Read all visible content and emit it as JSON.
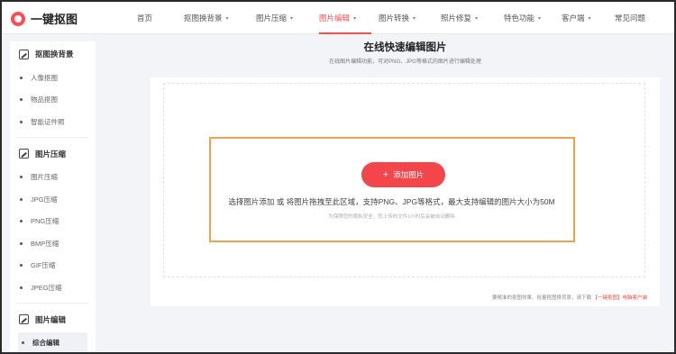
{
  "brand": {
    "name": "一键抠图"
  },
  "nav": [
    {
      "label": "首页",
      "dropdown": false,
      "active": false
    },
    {
      "label": "抠图换背景",
      "dropdown": true,
      "active": false
    },
    {
      "label": "图片压缩",
      "dropdown": true,
      "active": false
    },
    {
      "label": "图片编辑",
      "dropdown": true,
      "active": true
    },
    {
      "label": "图片转换",
      "dropdown": true,
      "active": false
    },
    {
      "label": "照片修复",
      "dropdown": true,
      "active": false
    },
    {
      "label": "特色功能",
      "dropdown": true,
      "active": false
    },
    {
      "label": "客户端",
      "dropdown": true,
      "active": false
    },
    {
      "label": "常见问题",
      "dropdown": false,
      "active": false
    }
  ],
  "sidebar": {
    "groups": [
      {
        "title": "抠图换背景",
        "icon": "image-icon",
        "items": [
          "人像抠图",
          "物品抠图",
          "智能证件照"
        ]
      },
      {
        "title": "图片压缩",
        "icon": "image-icon",
        "items": [
          "图片压缩",
          "JPG压缩",
          "PNG压缩",
          "BMP压缩",
          "GIF压缩",
          "JPEG压缩"
        ]
      },
      {
        "title": "图片编辑",
        "icon": "image-edit-icon",
        "items": [
          "综合编辑"
        ]
      }
    ],
    "active_item": "综合编辑"
  },
  "main": {
    "title": "在线快速编辑图片",
    "subtitle": "在线图片编辑功能，可对PNG、JPG等格式的图片进行编辑处理",
    "add_button": "添加图片",
    "hint": "选择图片添加 或 将图片拖拽至此区域，支持PNG、JPG等格式，最大支持编辑的图片大小为50M",
    "privacy_note": "为保障您的隐私安全，您上传的文件1小时后会被自动删除",
    "footer_prefix": "要精准的抠图效果、批量抠图换背景，请下载",
    "footer_link": "【一键抠图】电脑客户端"
  },
  "colors": {
    "accent": "#f2464b",
    "highlight_border": "#f0a34a"
  }
}
